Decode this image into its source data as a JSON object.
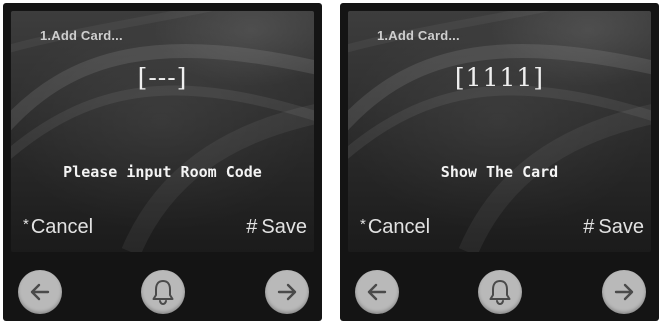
{
  "panels": [
    {
      "title": "1.Add Card...",
      "code_display": "[---]",
      "prompt": "Please input Room Code",
      "cancel_key": "*",
      "cancel_label": "Cancel",
      "save_key": "#",
      "save_label": "Save"
    },
    {
      "title": "1.Add Card...",
      "code_display": "[1111]",
      "prompt": "Show The Card",
      "cancel_key": "*",
      "cancel_label": "Cancel",
      "save_key": "#",
      "save_label": "Save"
    }
  ],
  "nav_icons": [
    "back-arrow-icon",
    "bell-icon",
    "forward-arrow-icon"
  ],
  "colors": {
    "device_bezel": "#141414",
    "screen_text": "#f4f4f4",
    "title_text": "#cfcfcf",
    "round_button": "#b9b9b9",
    "icon_stroke": "#4a4a4a"
  }
}
